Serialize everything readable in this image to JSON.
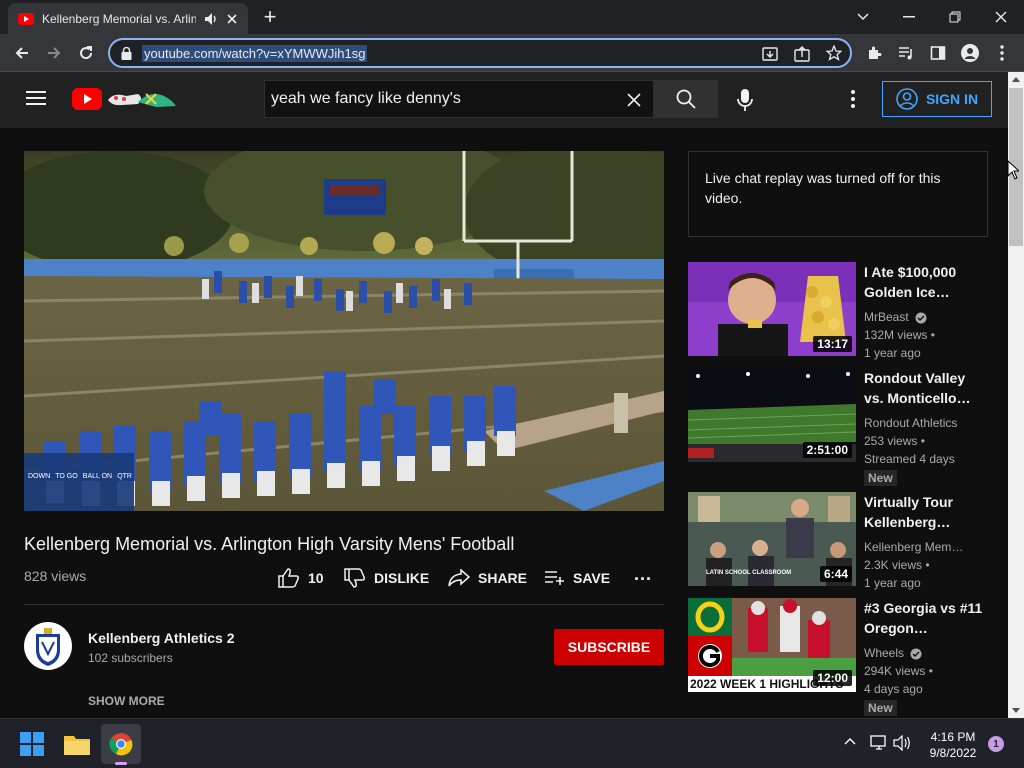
{
  "browser": {
    "tab_title": "Kellenberg Memorial vs. Arlin",
    "url": "youtube.com/watch?v=xYMWWJih1sg",
    "new_tab": "+"
  },
  "youtube": {
    "search_value": "yeah we fancy like denny's",
    "signin_label": "SIGN IN",
    "video": {
      "title": "Kellenberg Memorial vs. Arlington High Varsity Mens' Football",
      "views": "828 views",
      "like_count": "10",
      "dislike_label": "DISLIKE",
      "share_label": "SHARE",
      "save_label": "SAVE",
      "more_label": "..."
    },
    "channel": {
      "name": "Kellenberg Athletics 2",
      "subscribers": "102 subscribers",
      "subscribe_label": "SUBSCRIBE",
      "show_more": "SHOW MORE"
    },
    "chat_message": "Live chat replay was turned off for this video.",
    "recommendations": [
      {
        "title": "I Ate $100,000 Golden Ice…",
        "channel": "MrBeast",
        "verified": true,
        "views": "132M views •",
        "age": "1 year ago",
        "duration": "13:17",
        "badge": ""
      },
      {
        "title": "Rondout Valley vs. Monticello…",
        "channel": "Rondout Athletics",
        "verified": false,
        "views": "253 views •",
        "age": "Streamed 4 days",
        "duration": "2:51:00",
        "badge": "New"
      },
      {
        "title": "Virtually Tour Kellenberg…",
        "channel": "Kellenberg Mem…",
        "verified": false,
        "views": "2.3K views •",
        "age": "1 year ago",
        "duration": "6:44",
        "badge": ""
      },
      {
        "title": "#3 Georgia vs #11 Oregon…",
        "channel": "Wheels",
        "verified": true,
        "views": "294K views •",
        "age": "4 days ago",
        "duration": "12:00",
        "badge": "New"
      }
    ],
    "thumb_text": {
      "school": "LATIN SCHOOL CLASSROOM",
      "week": "2022 WEEK 1 HIGHLIGHTS"
    },
    "scoreboard": [
      "DOWN",
      "TO GO",
      "BALL ON",
      "QTR"
    ]
  },
  "taskbar": {
    "time": "4:16 PM",
    "date": "9/8/2022",
    "notification_count": "1"
  },
  "colors": {
    "accent": "#3ea6ff",
    "subscribe": "#cc0000",
    "youtube_red": "#ff0000",
    "background": "#0f0f0f"
  }
}
